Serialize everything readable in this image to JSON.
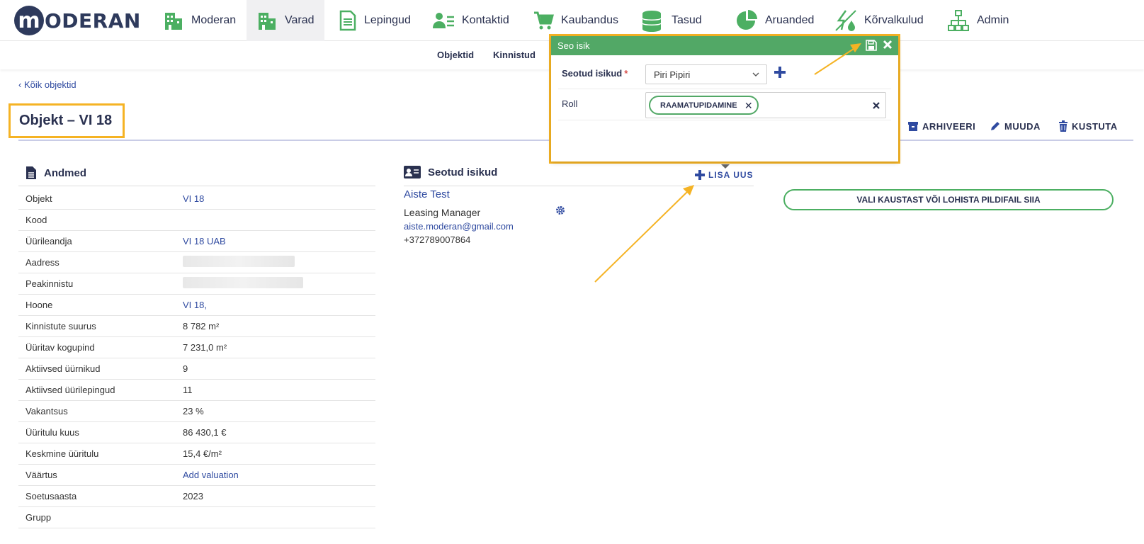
{
  "brand": {
    "logo_letter": "m",
    "logo_text": "ODERAN"
  },
  "nav": [
    {
      "label": "Moderan",
      "icon": "building-icon"
    },
    {
      "label": "Varad",
      "icon": "building-icon",
      "active": true
    },
    {
      "label": "Lepingud",
      "icon": "document-icon"
    },
    {
      "label": "Kontaktid",
      "icon": "contact-icon"
    },
    {
      "label": "Kaubandus",
      "icon": "cart-icon"
    },
    {
      "label": "Tasud",
      "icon": "coins-icon"
    },
    {
      "label": "Aruanded",
      "icon": "pie-chart-icon"
    },
    {
      "label": "Kõrvalkulud",
      "icon": "utilities-icon"
    },
    {
      "label": "Admin",
      "icon": "org-chart-icon"
    }
  ],
  "subnav": [
    "Objektid",
    "Kinnistud"
  ],
  "back_link": "‹ Kõik objektid",
  "page_title": "Objekt – VI 18",
  "actions": {
    "archive": "ARHIVEERI",
    "edit": "MUUDA",
    "delete": "KUSTUTA"
  },
  "andmed": {
    "heading": "Andmed",
    "rows": [
      {
        "label": "Objekt",
        "value": "VI 18",
        "link": true
      },
      {
        "label": "Kood",
        "value": ""
      },
      {
        "label": "Üürileandja",
        "value": "VI 18 UAB",
        "link": true
      },
      {
        "label": "Aadress",
        "value": "",
        "blurred": true
      },
      {
        "label": "Peakinnistu",
        "value": "",
        "blurred": true
      },
      {
        "label": "Hoone",
        "value": "VI 18,",
        "link": true
      },
      {
        "label": "Kinnistute suurus",
        "value": "8 782 m²"
      },
      {
        "label": "Üüritav kogupind",
        "value": "7 231,0 m²"
      },
      {
        "label": "Aktiivsed üürnikud",
        "value": "9"
      },
      {
        "label": "Aktiivsed üürilepingud",
        "value": "11"
      },
      {
        "label": "Vakantsus",
        "value": "23 %"
      },
      {
        "label": "Üüritulu kuus",
        "value": "86 430,1 €"
      },
      {
        "label": "Keskmine üüritulu",
        "value": "15,4 €/m²"
      },
      {
        "label": "Väärtus",
        "value": "Add valuation",
        "link": true
      },
      {
        "label": "Soetusaasta",
        "value": "2023"
      },
      {
        "label": "Grupp",
        "value": ""
      }
    ]
  },
  "seotud": {
    "heading": "Seotud isikud",
    "add_label": "LISA UUS",
    "person": {
      "name": "Aiste Test",
      "role": "Leasing Manager",
      "email": "aiste.moderan@gmail.com",
      "phone": "+372789007864"
    }
  },
  "upload_label": "VALI KAUSTAST VÕI LOHISTA PILDIFAIL SIIA",
  "popup": {
    "title": "Seo isik",
    "person_label": "Seotud isikud",
    "required_mark": "*",
    "person_value": "Piri Pipiri",
    "role_label": "Roll",
    "role_tag": "RAAMATUPIDAMINE"
  },
  "colors": {
    "green": "#52a866",
    "navy": "#2a3150",
    "link": "#2f4aa0",
    "highlight": "#f5b324"
  }
}
